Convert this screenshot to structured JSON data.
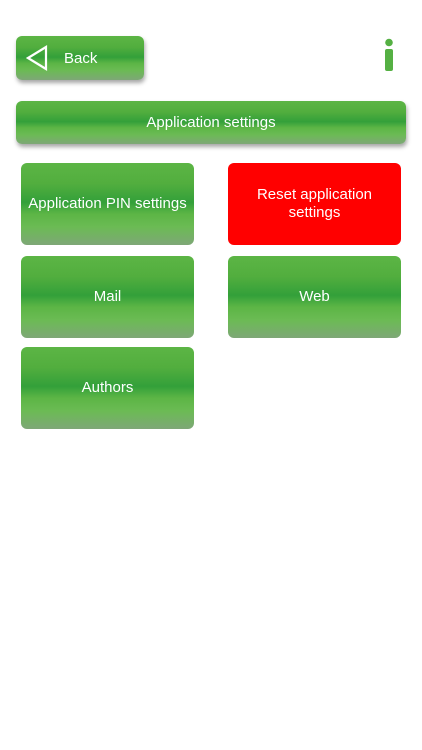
{
  "header": {
    "back_label": "Back",
    "info_icon": "info-icon",
    "back_icon": "back-arrow-icon"
  },
  "title_bar": {
    "label": "Application settings"
  },
  "tiles": [
    {
      "label": "Application PIN settings",
      "color": "#4caf50"
    },
    {
      "label": "Reset application settings",
      "color": "#ff0000"
    },
    {
      "label": "Mail",
      "color": "#4caf50"
    },
    {
      "label": "Web",
      "color": "#4caf50"
    },
    {
      "label": "Authors",
      "color": "#4caf50"
    }
  ],
  "colors": {
    "accent_green": "#4caf50",
    "danger_red": "#ff0000",
    "background": "#ffffff"
  }
}
